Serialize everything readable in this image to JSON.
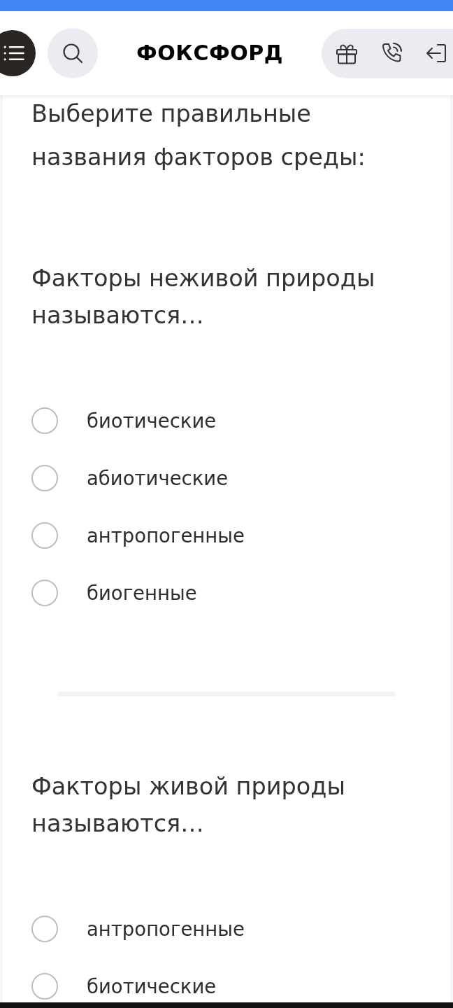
{
  "header": {
    "logo": "ФОКСФОРД"
  },
  "quiz": {
    "instruction": "Выберите правильные названия факторов среды:",
    "questions": [
      {
        "prompt": "Факторы неживой природы называются…",
        "options": [
          {
            "label": "биотические",
            "selected": false
          },
          {
            "label": "абиотические",
            "selected": false
          },
          {
            "label": "антропогенные",
            "selected": false
          },
          {
            "label": "биогенные",
            "selected": false
          }
        ]
      },
      {
        "prompt": "Факторы живой природы называются…",
        "options": [
          {
            "label": "антропогенные",
            "selected": false
          },
          {
            "label": "биотические",
            "selected": false
          }
        ]
      }
    ]
  }
}
